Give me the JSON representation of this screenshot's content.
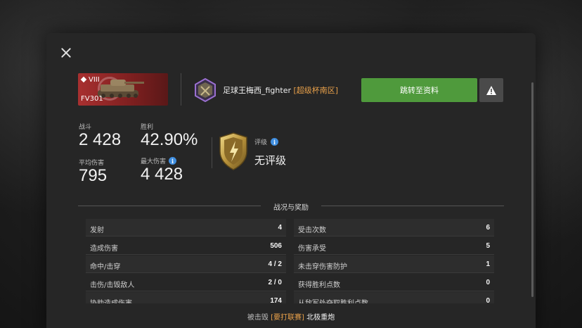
{
  "tank": {
    "tier": "VIII",
    "name": "FV301"
  },
  "player": {
    "name": "足球王梅西_fighter",
    "clan": "[超级杯南区]"
  },
  "buttons": {
    "profile": "跳转至资料"
  },
  "stats": {
    "battles": {
      "label": "战斗",
      "value": "2 428"
    },
    "wins": {
      "label": "胜利",
      "value": "42.90%"
    },
    "avg_damage": {
      "label": "平均伤害",
      "value": "795"
    },
    "max_damage": {
      "label": "最大伤害",
      "value": "4 428"
    }
  },
  "rating": {
    "label": "评级",
    "value": "无评级"
  },
  "section": {
    "title": "战况与奖励"
  },
  "left_rows": [
    {
      "k": "发射",
      "v": "4"
    },
    {
      "k": "造成伤害",
      "v": "506"
    },
    {
      "k": "命中/击穿",
      "v": "4 / 2"
    },
    {
      "k": "击伤/击毁敌人",
      "v": "2 / 0"
    },
    {
      "k": "协助造成伤害",
      "v": "174"
    }
  ],
  "right_rows": [
    {
      "k": "受击次数",
      "v": "6"
    },
    {
      "k": "伤害承受",
      "v": "5"
    },
    {
      "k": "未击穿伤害防护",
      "v": "1"
    },
    {
      "k": "获得胜利点数",
      "v": "0"
    },
    {
      "k": "从敌军处夺取胜利点数",
      "v": "0"
    }
  ],
  "killed_by": {
    "prefix": "被击毁",
    "clan": "[要打联赛]",
    "player": "北极重炮"
  },
  "colors": {
    "accent_green": "#4f9a3c",
    "clan_orange": "#e8a04a",
    "info_blue": "#3f8ee0"
  }
}
